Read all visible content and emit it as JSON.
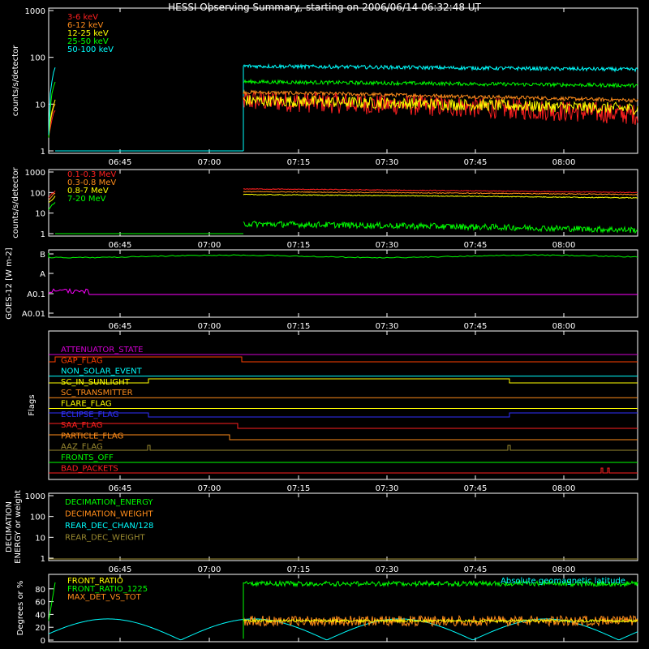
{
  "title": "HESSI Observing Summary, starting on 2006/06/14 06:32:48 UT",
  "time_ticks": [
    "06:45",
    "07:00",
    "07:15",
    "07:30",
    "07:45",
    "08:00"
  ],
  "chart_data": [
    {
      "type": "line",
      "panel": "lightcurve",
      "ylabel": "counts/s/detector",
      "yscale": "log",
      "ylim": [
        1,
        1000
      ],
      "ytick_labels": [
        "1",
        "10",
        "100",
        "1000"
      ],
      "series": [
        {
          "name": "3-6 keV",
          "color": "#ff2020",
          "level_start": 7,
          "level_after": [
            12,
            6
          ]
        },
        {
          "name": "6-12 keV",
          "color": "#ff8c1a",
          "level_start": 10,
          "level_after": [
            18,
            12
          ]
        },
        {
          "name": "12-25 keV",
          "color": "#ffff00",
          "level_start": 12,
          "level_after": [
            12,
            8
          ]
        },
        {
          "name": "25-50 keV",
          "color": "#00ff00",
          "level_start": 30,
          "level_after": [
            30,
            25
          ]
        },
        {
          "name": "50-100 keV",
          "color": "#00ffff",
          "level_start": 60,
          "level_after": [
            65,
            55
          ]
        }
      ]
    },
    {
      "type": "line",
      "panel": "high_energy",
      "ylabel": "counts/s/detector",
      "yscale": "log",
      "ylim": [
        1,
        1000
      ],
      "ytick_labels": [
        "1",
        "10",
        "100",
        "1000"
      ],
      "series": [
        {
          "name": "0.1-0.3 MeV",
          "color": "#ff2020",
          "level_start": 110,
          "level_after": [
            150,
            100
          ]
        },
        {
          "name": "0.3-0.8 MeV",
          "color": "#ff8c1a",
          "level_start": 90,
          "level_after": [
            110,
            80
          ]
        },
        {
          "name": "0.8-7 MeV",
          "color": "#ffff00",
          "level_start": 60,
          "level_after": [
            80,
            55
          ]
        },
        {
          "name": "7-20 MeV",
          "color": "#00ff00",
          "level_start": 30,
          "level_after": [
            3,
            1.5
          ]
        }
      ]
    },
    {
      "type": "line",
      "panel": "goes",
      "ylabel": "GOES-12 [W m-2]",
      "ytick_labels": [
        "B",
        "A",
        "A0.1",
        "A0.01"
      ],
      "series": [
        {
          "color": "#00ff00",
          "trace": "B"
        },
        {
          "color": "#ff00ff",
          "trace": "A0.1"
        }
      ]
    },
    {
      "type": "table",
      "panel": "flags",
      "ylabel": "Flags",
      "flags": [
        {
          "name": "ATTENUATOR_STATE",
          "color": "#d000d0"
        },
        {
          "name": "GAP_FLAG",
          "color": "#ff4000"
        },
        {
          "name": "NON_SOLAR_EVENT",
          "color": "#00ffff"
        },
        {
          "name": "SC_IN_SUNLIGHT",
          "color": "#ffff00"
        },
        {
          "name": "SC_TRANSMITTER",
          "color": "#ff8c1a"
        },
        {
          "name": "FLARE_FLAG",
          "color": "#ffff00"
        },
        {
          "name": "ECLIPSE_FLAG",
          "color": "#3030ff"
        },
        {
          "name": "SAA_FLAG",
          "color": "#ff2020"
        },
        {
          "name": "PARTICLE_FLAG",
          "color": "#ff8c1a"
        },
        {
          "name": "AAZ_FLAG",
          "color": "#9a8a30"
        },
        {
          "name": "FRONTS_OFF",
          "color": "#00ff00"
        },
        {
          "name": "BAD_PACKETS",
          "color": "#ff2020"
        }
      ]
    },
    {
      "type": "line",
      "panel": "decimation",
      "ylabel": "DECIMATION ENERGY or weight",
      "yscale": "log",
      "ytick_labels": [
        "1",
        "10",
        "100",
        "1000"
      ],
      "series": [
        {
          "name": "DECIMATION_ENERGY",
          "color": "#00ff00"
        },
        {
          "name": "DECIMATION_WEIGHT",
          "color": "#ff8c1a"
        },
        {
          "name": "REAR_DEC_CHAN/128",
          "color": "#00ffff"
        },
        {
          "name": "REAR_DEC_WEIGHT",
          "color": "#9a8a30"
        }
      ]
    },
    {
      "type": "line",
      "panel": "ratios",
      "ylabel": "Degrees or %",
      "ylim": [
        0,
        100
      ],
      "ytick_labels": [
        "0",
        "20",
        "40",
        "60",
        "80"
      ],
      "annotation": "Absolute geomagnetic latitude",
      "series": [
        {
          "name": "FRONT_RATIO",
          "color": "#ffff00"
        },
        {
          "name": "FRONT_RATIO_1225",
          "color": "#00ff00"
        },
        {
          "name": "MAX_DET_VS_TOT",
          "color": "#ff8c1a"
        }
      ]
    }
  ]
}
